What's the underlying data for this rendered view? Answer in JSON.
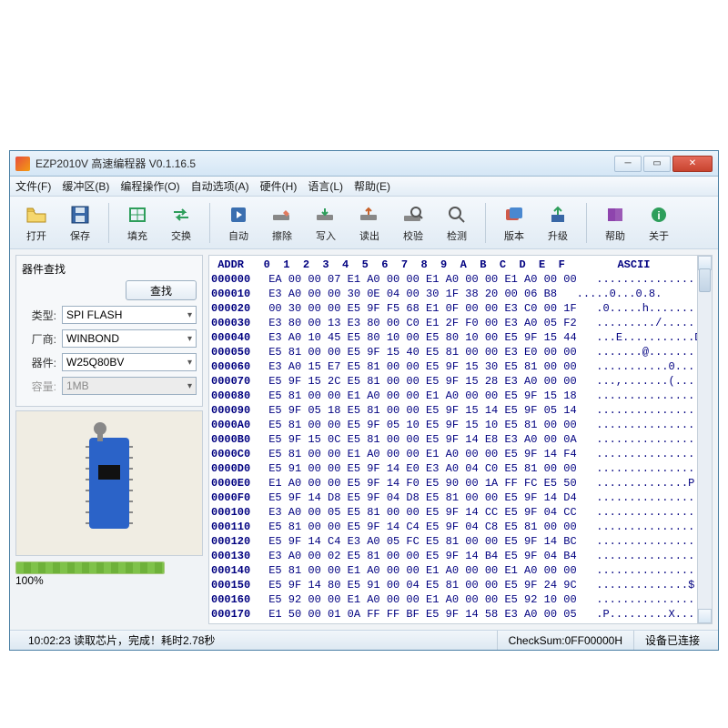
{
  "window": {
    "title": "EZP2010V 高速编程器 V0.1.16.5"
  },
  "menu": {
    "file": "文件(F)",
    "buffer": "缓冲区(B)",
    "ops": "编程操作(O)",
    "auto": "自动选项(A)",
    "hw": "硬件(H)",
    "lang": "语言(L)",
    "help": "帮助(E)"
  },
  "toolbar": {
    "open": "打开",
    "save": "保存",
    "fill": "填充",
    "swap": "交换",
    "auto": "自动",
    "erase": "擦除",
    "write": "写入",
    "read": "读出",
    "verify": "校验",
    "detect": "检测",
    "version": "版本",
    "upgrade": "升级",
    "helpb": "帮助",
    "about": "关于"
  },
  "device": {
    "group_title": "器件查找",
    "find_btn": "查找",
    "type_lbl": "类型:",
    "type_val": "SPI FLASH",
    "vendor_lbl": "厂商:",
    "vendor_val": "WINBOND",
    "part_lbl": "器件:",
    "part_val": "W25Q80BV",
    "cap_lbl": "容量:",
    "cap_val": "1MB"
  },
  "progress": {
    "pct": "100%"
  },
  "status": {
    "left": "10:02:23 读取芯片，完成！耗时2.78秒",
    "checksum": "CheckSum:0FF00000H",
    "conn": "设备已连接"
  },
  "hex": {
    "header": " ADDR   0  1  2  3  4  5  6  7  8  9  A  B  C  D  E  F        ASCII",
    "rows": [
      {
        "a": "000000",
        "h": "EA 00 00 07 E1 A0 00 00 E1 A0 00 00 E1 A0 00 00",
        "s": "................"
      },
      {
        "a": "000010",
        "h": "E3 A0 00 00 30 0E 04 00 30 1F 38 20 00 06 B8",
        "s": ".....0...0.8."
      },
      {
        "a": "000020",
        "h": "00 30 00 00 E5 9F F5 68 E1 0F 00 00 E3 C0 00 1F",
        "s": ".0.....h........"
      },
      {
        "a": "000030",
        "h": "E3 80 00 13 E3 80 00 C0 E1 2F F0 00 E3 A0 05 F2",
        "s": "........./......"
      },
      {
        "a": "000040",
        "h": "E3 A0 10 45 E5 80 10 00 E5 80 10 00 E5 9F 15 44",
        "s": "...E...........D"
      },
      {
        "a": "000050",
        "h": "E5 81 00 00 E5 9F 15 40 E5 81 00 00 E3 E0 00 00",
        "s": ".......@........"
      },
      {
        "a": "000060",
        "h": "E3 A0 15 E7 E5 81 00 00 E5 9F 15 30 E5 81 00 00",
        "s": "...........0...."
      },
      {
        "a": "000070",
        "h": "E5 9F 15 2C E5 81 00 00 E5 9F 15 28 E3 A0 00 00",
        "s": "...,.......(....."
      },
      {
        "a": "000080",
        "h": "E5 81 00 00 E1 A0 00 00 E1 A0 00 00 E5 9F 15 18",
        "s": "................"
      },
      {
        "a": "000090",
        "h": "E5 9F 05 18 E5 81 00 00 E5 9F 15 14 E5 9F 05 14",
        "s": "................"
      },
      {
        "a": "0000A0",
        "h": "E5 81 00 00 E5 9F 05 10 E5 9F 15 10 E5 81 00 00",
        "s": "................"
      },
      {
        "a": "0000B0",
        "h": "E5 9F 15 0C E5 81 00 00 E5 9F 14 E8 E3 A0 00 0A",
        "s": "................"
      },
      {
        "a": "0000C0",
        "h": "E5 81 00 00 E1 A0 00 00 E1 A0 00 00 E5 9F 14 F4",
        "s": "................"
      },
      {
        "a": "0000D0",
        "h": "E5 91 00 00 E5 9F 14 E0 E3 A0 04 C0 E5 81 00 00",
        "s": "................"
      },
      {
        "a": "0000E0",
        "h": "E1 A0 00 00 E5 9F 14 F0 E5 90 00 1A FF FC E5 50",
        "s": "..............P"
      },
      {
        "a": "0000F0",
        "h": "E5 9F 14 D8 E5 9F 04 D8 E5 81 00 00 E5 9F 14 D4",
        "s": "................"
      },
      {
        "a": "000100",
        "h": "E3 A0 00 05 E5 81 00 00 E5 9F 14 CC E5 9F 04 CC",
        "s": "................"
      },
      {
        "a": "000110",
        "h": "E5 81 00 00 E5 9F 14 C4 E5 9F 04 C8 E5 81 00 00",
        "s": "................"
      },
      {
        "a": "000120",
        "h": "E5 9F 14 C4 E3 A0 05 FC E5 81 00 00 E5 9F 14 BC",
        "s": "................"
      },
      {
        "a": "000130",
        "h": "E3 A0 00 02 E5 81 00 00 E5 9F 14 B4 E5 9F 04 B4",
        "s": "................"
      },
      {
        "a": "000140",
        "h": "E5 81 00 00 E1 A0 00 00 E1 A0 00 00 E1 A0 00 00",
        "s": "................"
      },
      {
        "a": "000150",
        "h": "E5 9F 14 80 E5 91 00 04 E5 81 00 00 E5 9F 24 9C",
        "s": "..............$."
      },
      {
        "a": "000160",
        "h": "E5 92 00 00 E1 A0 00 00 E1 A0 00 00 E5 92 10 00",
        "s": "................"
      },
      {
        "a": "000170",
        "h": "E1 50 00 01 0A FF FF BF E5 9F 14 58 E3 A0 00 05",
        "s": ".P.........X....."
      }
    ]
  }
}
